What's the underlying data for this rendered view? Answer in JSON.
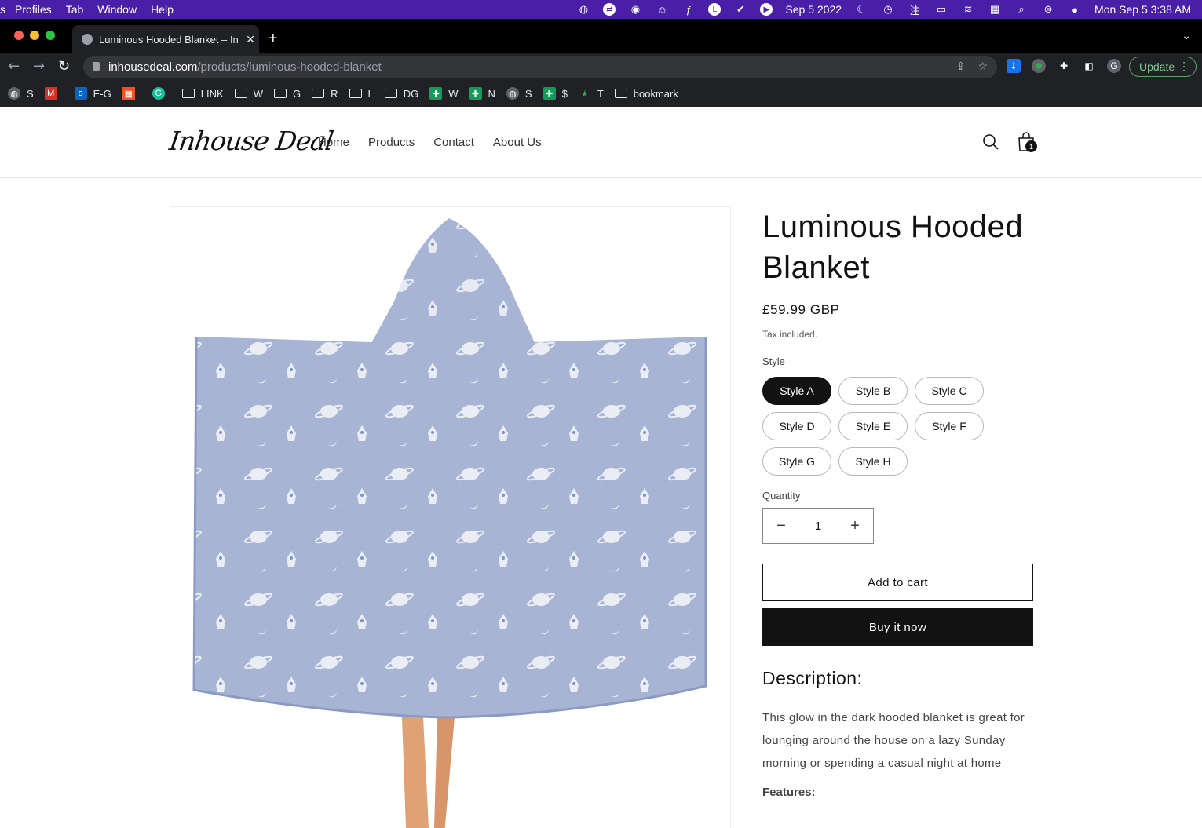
{
  "menubar": {
    "app_items": [
      "s",
      "Profiles",
      "Tab",
      "Window",
      "Help"
    ],
    "date": "Sep 5 2022",
    "datetime": "Mon Sep 5  3:38 AM"
  },
  "browser": {
    "tab_title": "Luminous Hooded Blanket – In",
    "url_host": "inhousedeal.com",
    "url_path": "/products/luminous-hooded-blanket",
    "update_label": "Update",
    "profile_initial": "G",
    "bookmarks": [
      {
        "icon": "globe-icon",
        "label": "S"
      },
      {
        "icon": "gmail-icon",
        "label": ""
      },
      {
        "icon": "outlook-icon",
        "label": "E-G"
      },
      {
        "icon": "microsoft-icon",
        "label": ""
      },
      {
        "icon": "grammarly-icon",
        "label": ""
      },
      {
        "icon": "folder-icon",
        "label": "LINK"
      },
      {
        "icon": "folder-icon",
        "label": "W"
      },
      {
        "icon": "folder-icon",
        "label": "G"
      },
      {
        "icon": "folder-icon",
        "label": "R"
      },
      {
        "icon": "folder-icon",
        "label": "L"
      },
      {
        "icon": "folder-icon",
        "label": "DG"
      },
      {
        "icon": "sheets-icon",
        "label": "W"
      },
      {
        "icon": "sheets-icon",
        "label": "N"
      },
      {
        "icon": "globe-icon",
        "label": "S"
      },
      {
        "icon": "sheets-icon",
        "label": "$"
      },
      {
        "icon": "star-icon",
        "label": "T"
      },
      {
        "icon": "folder-icon",
        "label": "bookmark"
      }
    ]
  },
  "store": {
    "logo": "Inhouse Deal",
    "nav": [
      "Home",
      "Products",
      "Contact",
      "About Us"
    ],
    "cart_count": "1"
  },
  "product": {
    "title": "Luminous Hooded Blanket",
    "price": "£59.99 GBP",
    "tax_note": "Tax included.",
    "style_label": "Style",
    "styles": [
      "Style A",
      "Style B",
      "Style C",
      "Style D",
      "Style E",
      "Style F",
      "Style G",
      "Style H"
    ],
    "selected_style": "Style A",
    "quantity_label": "Quantity",
    "quantity": "1",
    "add_to_cart": "Add to cart",
    "buy_now": "Buy it now",
    "description_heading": "Description:",
    "description": "This glow in the dark hooded blanket is great for lounging around the house on a lazy Sunday morning or spending a casual night at home",
    "features_heading": "Features:"
  },
  "colors": {
    "menubar": "#4a1fa8",
    "chrome_dark": "#202124",
    "primary": "#121212",
    "blanket": "#a7b4d3"
  }
}
